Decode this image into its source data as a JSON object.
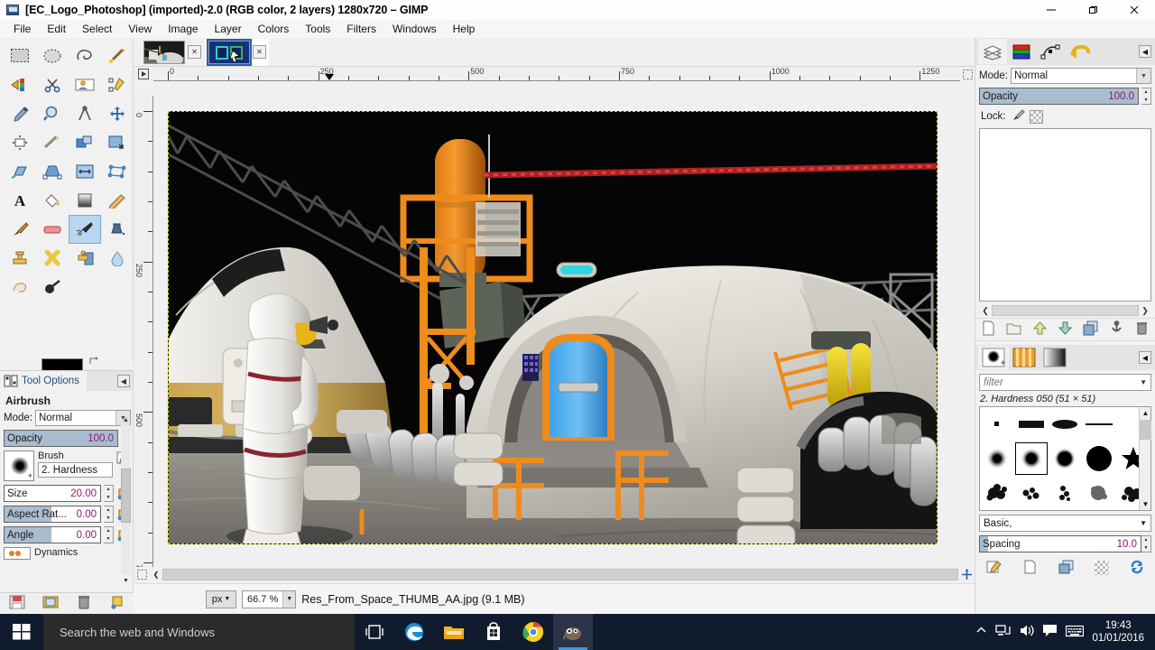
{
  "window": {
    "title": "[EC_Logo_Photoshop] (imported)-2.0 (RGB color, 2 layers) 1280x720 – GIMP",
    "minimize": "–",
    "maximize": "❐",
    "close": "✕"
  },
  "menubar": {
    "items": [
      "File",
      "Edit",
      "Select",
      "View",
      "Image",
      "Layer",
      "Colors",
      "Tools",
      "Filters",
      "Windows",
      "Help"
    ]
  },
  "toolbox": {
    "tools": [
      {
        "name": "rect-select-tool",
        "label": "Rectangle Select"
      },
      {
        "name": "ellipse-select-tool",
        "label": "Ellipse Select"
      },
      {
        "name": "free-select-tool",
        "label": "Free Select"
      },
      {
        "name": "fuzzy-select-tool",
        "label": "Fuzzy Select"
      },
      {
        "name": "select-by-color-tool",
        "label": "Select by Color"
      },
      {
        "name": "scissors-select-tool",
        "label": "Scissors Select"
      },
      {
        "name": "foreground-select-tool",
        "label": "Foreground Select"
      },
      {
        "name": "paths-tool",
        "label": "Paths"
      },
      {
        "name": "color-picker-tool",
        "label": "Color Picker"
      },
      {
        "name": "zoom-tool",
        "label": "Zoom"
      },
      {
        "name": "measure-tool",
        "label": "Measure"
      },
      {
        "name": "move-tool",
        "label": "Move"
      },
      {
        "name": "align-tool",
        "label": "Alignment"
      },
      {
        "name": "crop-tool",
        "label": "Crop"
      },
      {
        "name": "rotate-tool",
        "label": "Rotate"
      },
      {
        "name": "scale-tool",
        "label": "Scale"
      },
      {
        "name": "shear-tool",
        "label": "Shear"
      },
      {
        "name": "perspective-tool",
        "label": "Perspective"
      },
      {
        "name": "flip-tool",
        "label": "Flip"
      },
      {
        "name": "cage-transform-tool",
        "label": "Cage Transform"
      },
      {
        "name": "text-tool",
        "label": "Text"
      },
      {
        "name": "bucket-fill-tool",
        "label": "Bucket Fill"
      },
      {
        "name": "gradient-tool",
        "label": "Gradient"
      },
      {
        "name": "pencil-tool",
        "label": "Pencil"
      },
      {
        "name": "paintbrush-tool",
        "label": "Paintbrush"
      },
      {
        "name": "eraser-tool",
        "label": "Eraser"
      },
      {
        "name": "airbrush-tool",
        "label": "Airbrush"
      },
      {
        "name": "ink-tool",
        "label": "Ink"
      },
      {
        "name": "clone-tool",
        "label": "Clone"
      },
      {
        "name": "heal-tool",
        "label": "Heal"
      },
      {
        "name": "perspective-clone-tool",
        "label": "Perspective Clone"
      },
      {
        "name": "blur-sharpen-tool",
        "label": "Blur / Sharpen"
      },
      {
        "name": "smudge-tool",
        "label": "Smudge"
      },
      {
        "name": "dodge-burn-tool",
        "label": "Dodge / Burn"
      }
    ],
    "selected_index": 26,
    "foreground_color": "#000000",
    "background_color": "#ffffff"
  },
  "tool_options": {
    "tab_label": "Tool Options",
    "title": "Airbrush",
    "mode_label": "Mode:",
    "mode_value": "Normal",
    "opacity_label": "Opacity",
    "opacity_value": "100.0",
    "brush_label": "Brush",
    "brush_value": "2. Hardness ",
    "size_label": "Size",
    "size_value": "20.00",
    "aspect_label": "Aspect Rat...",
    "aspect_value": "0.00",
    "angle_label": "Angle",
    "angle_value": "0.00",
    "dynamics_label": "Dynamics",
    "footer_buttons": [
      "save-tool-preset",
      "restore-tool-preset",
      "delete-tool-preset",
      "reset-tool-options"
    ]
  },
  "image_tabs": [
    {
      "name": "image-tab-space-scene",
      "label": "Res_From_Space_THUMB_AA.jpg",
      "active": false,
      "close": "✕"
    },
    {
      "name": "image-tab-ec-logo",
      "label": "EC_Logo_Photoshop",
      "active": true,
      "close": "✕"
    }
  ],
  "rulers": {
    "unit": "px",
    "horizontal_ticks": [
      "0",
      "250",
      "500",
      "750",
      "1000",
      "1250"
    ],
    "vertical_ticks": [
      "0",
      "250",
      "500",
      "7"
    ]
  },
  "statusbar": {
    "unit": "px",
    "zoom": "66.7 %",
    "file_info": "Res_From_Space_THUMB_AA.jpg (9.1 MB)"
  },
  "layers_dock": {
    "tabs": [
      "layers-tab",
      "channels-tab",
      "paths-tab",
      "undo-history-tab"
    ],
    "active_tab": 0,
    "mode_label": "Mode:",
    "mode_value": "Normal",
    "opacity_label": "Opacity",
    "opacity_value": "100.0",
    "lock_label": "Lock:",
    "lock_icons": [
      "lock-pixels-icon",
      "lock-alpha-icon"
    ],
    "buttons": [
      "new-layer-button",
      "new-layer-group-button",
      "raise-layer-button",
      "lower-layer-button",
      "duplicate-layer-button",
      "anchor-layer-button",
      "delete-layer-button"
    ]
  },
  "brushes_dock": {
    "tabs": [
      "brushes-tab",
      "patterns-tab",
      "gradients-tab"
    ],
    "active_tab": 0,
    "filter_placeholder": "filter",
    "selected_brush_info": "2. Hardness 050 (51 × 51)",
    "brush_set": "Basic,",
    "spacing_label": "Spacing",
    "spacing_value": "10.0",
    "footer_buttons": [
      "edit-brush-button",
      "new-brush-button",
      "duplicate-brush-button",
      "delete-brush-button",
      "refresh-brushes-button"
    ]
  },
  "taskbar": {
    "search_placeholder": "Search the web and Windows",
    "buttons": [
      "task-view-button",
      "edge-button",
      "file-explorer-button",
      "store-button",
      "chrome-button",
      "gimp-button"
    ],
    "tray": [
      "show-hidden-icons",
      "network-icon",
      "volume-icon",
      "action-center-icon",
      "keyboard-icon"
    ],
    "time": "19:43",
    "date": "01/01/2016"
  }
}
